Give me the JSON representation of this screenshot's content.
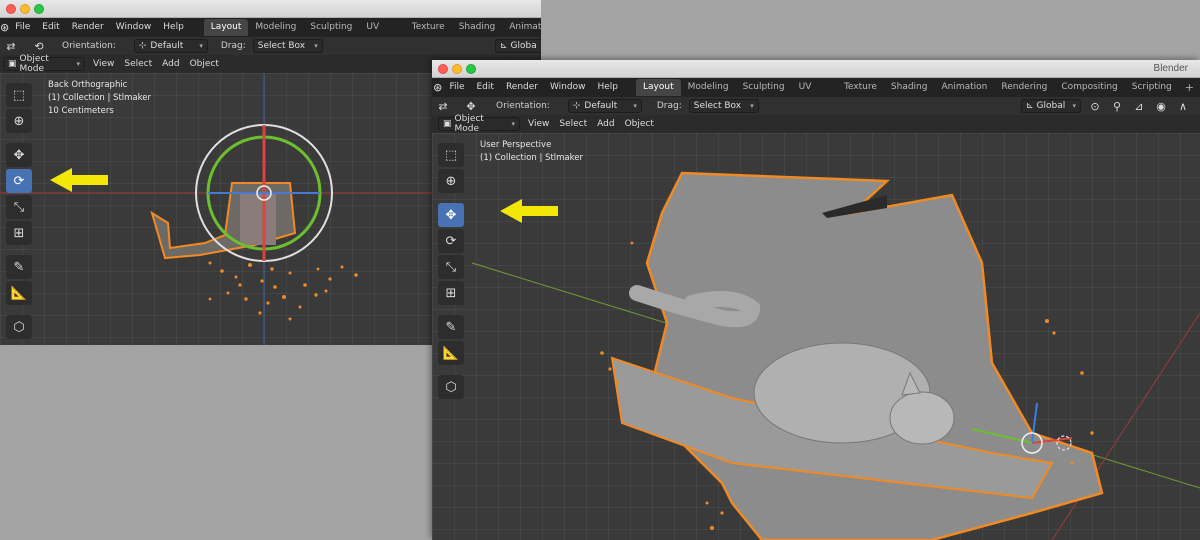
{
  "left_window": {
    "menu": [
      "File",
      "Edit",
      "Render",
      "Window",
      "Help"
    ],
    "tabs": [
      {
        "label": "Layout",
        "active": true
      },
      {
        "label": "Modeling",
        "active": false
      },
      {
        "label": "Sculpting",
        "active": false
      },
      {
        "label": "UV Editing",
        "active": false
      },
      {
        "label": "Texture Paint",
        "active": false
      },
      {
        "label": "Shading",
        "active": false
      },
      {
        "label": "Animation",
        "active": false
      }
    ],
    "orientation_label": "Orientation:",
    "orientation_value": "Default",
    "drag_label": "Drag:",
    "drag_value": "Select Box",
    "transform_label": "Globa",
    "mode": "Object Mode",
    "header_menu": [
      "View",
      "Select",
      "Add",
      "Object"
    ],
    "viewport_info": [
      "Back Orthographic",
      "(1) Collection | Stlmaker",
      "10 Centimeters"
    ]
  },
  "right_window": {
    "title": "Blender",
    "menu": [
      "File",
      "Edit",
      "Render",
      "Window",
      "Help"
    ],
    "tabs": [
      {
        "label": "Layout",
        "active": true
      },
      {
        "label": "Modeling",
        "active": false
      },
      {
        "label": "Sculpting",
        "active": false
      },
      {
        "label": "UV Editing",
        "active": false
      },
      {
        "label": "Texture Paint",
        "active": false
      },
      {
        "label": "Shading",
        "active": false
      },
      {
        "label": "Animation",
        "active": false
      },
      {
        "label": "Rendering",
        "active": false
      },
      {
        "label": "Compositing",
        "active": false
      },
      {
        "label": "Scripting",
        "active": false
      }
    ],
    "add_tab": "+",
    "orientation_label": "Orientation:",
    "orientation_value": "Default",
    "drag_label": "Drag:",
    "drag_value": "Select Box",
    "transform_label": "Global",
    "mode": "Object Mode",
    "header_menu": [
      "View",
      "Select",
      "Add",
      "Object"
    ],
    "viewport_info": [
      "User Perspective",
      "(1) Collection | Stlmaker"
    ]
  },
  "colors": {
    "accent": "#4772b3",
    "arrow": "#f5e60a",
    "selection_outline": "#f08a24",
    "mesh": "#9a9a9a"
  },
  "icons": {
    "left_active_tool": "rotate-icon",
    "right_active_tool": "move-icon"
  }
}
